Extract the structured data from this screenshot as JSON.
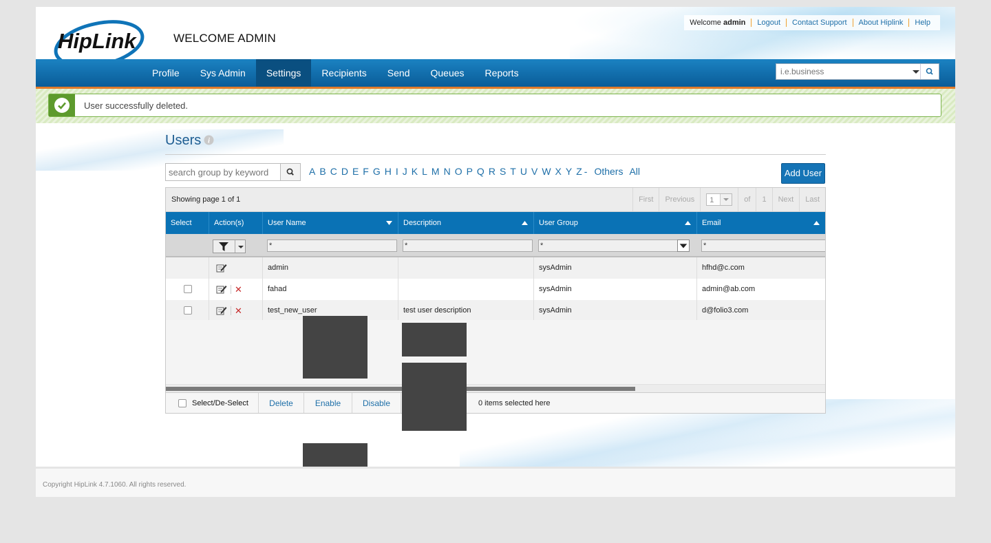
{
  "header": {
    "logo_text": "HipLink",
    "welcome_title": "WELCOME ADMIN",
    "welcome_prefix": "Welcome",
    "user": "admin",
    "links": [
      "Logout",
      "Contact Support",
      "About Hiplink",
      "Help"
    ]
  },
  "nav": {
    "items": [
      "Profile",
      "Sys Admin",
      "Settings",
      "Recipients",
      "Send",
      "Queues",
      "Reports"
    ],
    "active": "Settings",
    "search_placeholder": "i.e.business"
  },
  "banner": {
    "message": "User successfully deleted."
  },
  "users": {
    "title": "Users",
    "search_placeholder": "search group by keyword",
    "letters": [
      "A",
      "B",
      "C",
      "D",
      "E",
      "F",
      "G",
      "H",
      "I",
      "J",
      "K",
      "L",
      "M",
      "N",
      "O",
      "P",
      "Q",
      "R",
      "S",
      "T",
      "U",
      "V",
      "W",
      "X",
      "Y",
      "Z"
    ],
    "dash": "-",
    "others": "Others",
    "all": "All",
    "add_user_label": "Add User"
  },
  "grid": {
    "showing": "Showing page 1 of 1",
    "pager": {
      "first": "First",
      "previous": "Previous",
      "page": "1",
      "of": "of",
      "total": "1",
      "next": "Next",
      "last": "Last"
    },
    "columns": [
      "Select",
      "Action(s)",
      "User Name",
      "Description",
      "User Group",
      "Email"
    ],
    "filters": {
      "username": "*",
      "description": "*",
      "usergroup": "*",
      "email": "*"
    },
    "rows": [
      {
        "username": "admin",
        "description": "",
        "usergroup": "sysAdmin",
        "email": "hfhd@c.com"
      },
      {
        "username": "fahad",
        "description": "",
        "usergroup": "sysAdmin",
        "email": "admin@ab.com"
      },
      {
        "username": "test_new_user",
        "description": "test user description",
        "usergroup": "sysAdmin",
        "email": "d@folio3.com"
      }
    ],
    "footer": {
      "select_label": "Select/De-Select",
      "delete": "Delete",
      "enable": "Enable",
      "disable": "Disable",
      "count": "0 items selected here"
    }
  },
  "footer": {
    "copyright": "Copyright HipLink 4.7.1060. All rights reserved."
  },
  "colors": {
    "nav_blue": "#0a72b5",
    "accent_orange": "#e27b2a",
    "success_green": "#5d9a2d",
    "link_blue": "#1e6fa8"
  }
}
